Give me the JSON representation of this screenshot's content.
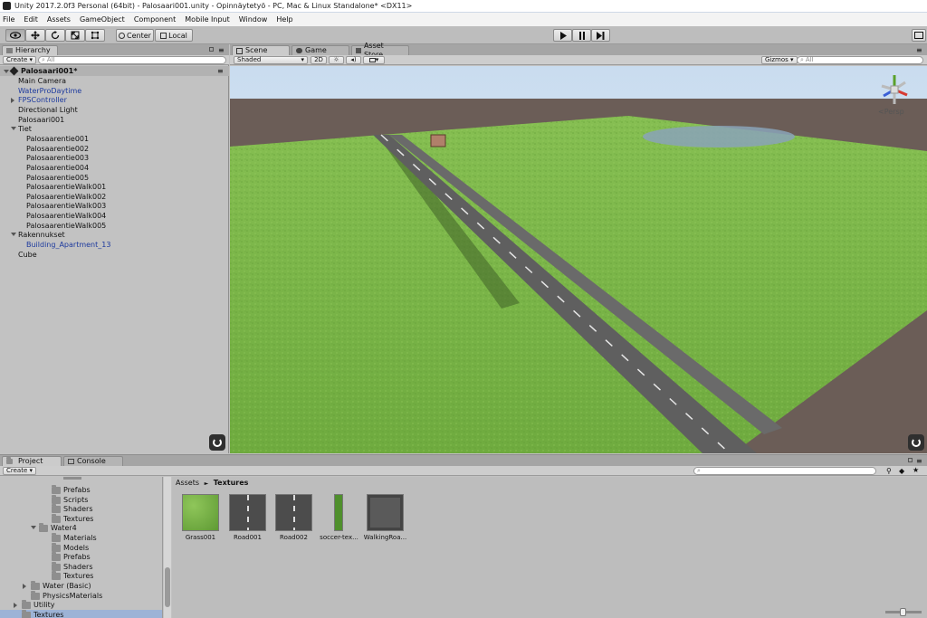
{
  "window": {
    "title": "Unity 2017.2.0f3 Personal (64bit) - Palosaari001.unity - Opinnäytetyö - PC, Mac & Linux Standalone* <DX11>"
  },
  "menu": [
    "File",
    "Edit",
    "Assets",
    "GameObject",
    "Component",
    "Mobile Input",
    "Window",
    "Help"
  ],
  "toolbar": {
    "center": "Center",
    "local": "Local"
  },
  "hierarchy": {
    "tab": "Hierarchy",
    "create": "Create",
    "search_placeholder": "All",
    "scene_name": "Palosaari001*",
    "items": [
      {
        "label": "Main Camera",
        "indent": 1,
        "blue": false,
        "arrow": ""
      },
      {
        "label": "WaterProDaytime",
        "indent": 1,
        "blue": true,
        "arrow": ""
      },
      {
        "label": "FPSController",
        "indent": 0,
        "blue": true,
        "arrow": "right"
      },
      {
        "label": "Directional Light",
        "indent": 1,
        "blue": false,
        "arrow": ""
      },
      {
        "label": "Palosaari001",
        "indent": 1,
        "blue": false,
        "arrow": ""
      },
      {
        "label": "Tiet",
        "indent": 0,
        "blue": false,
        "arrow": "down"
      },
      {
        "label": "Palosaarentie001",
        "indent": 2,
        "blue": false,
        "arrow": ""
      },
      {
        "label": "Palosaarentie002",
        "indent": 2,
        "blue": false,
        "arrow": ""
      },
      {
        "label": "Palosaarentie003",
        "indent": 2,
        "blue": false,
        "arrow": ""
      },
      {
        "label": "Palosaarentie004",
        "indent": 2,
        "blue": false,
        "arrow": ""
      },
      {
        "label": "Palosaarentie005",
        "indent": 2,
        "blue": false,
        "arrow": ""
      },
      {
        "label": "PalosaarentieWalk001",
        "indent": 2,
        "blue": false,
        "arrow": ""
      },
      {
        "label": "PalosaarentieWalk002",
        "indent": 2,
        "blue": false,
        "arrow": ""
      },
      {
        "label": "PalosaarentieWalk003",
        "indent": 2,
        "blue": false,
        "arrow": ""
      },
      {
        "label": "PalosaarentieWalk004",
        "indent": 2,
        "blue": false,
        "arrow": ""
      },
      {
        "label": "PalosaarentieWalk005",
        "indent": 2,
        "blue": false,
        "arrow": ""
      },
      {
        "label": "Rakennukset",
        "indent": 0,
        "blue": false,
        "arrow": "down"
      },
      {
        "label": "Building_Apartment_13",
        "indent": 2,
        "blue": true,
        "arrow": ""
      },
      {
        "label": "Cube",
        "indent": 1,
        "blue": false,
        "arrow": ""
      }
    ]
  },
  "scene": {
    "tabs": {
      "scene": "Scene",
      "game": "Game",
      "asset_store": "Asset Store"
    },
    "shading": "Shaded",
    "mode_2d": "2D",
    "gizmos": "Gizmos",
    "search_placeholder": "All",
    "persp": "Persp"
  },
  "project": {
    "tabs": {
      "project": "Project",
      "console": "Console"
    },
    "create": "Create",
    "tree": [
      {
        "label": "Prefabs",
        "indent": 3,
        "arrow": ""
      },
      {
        "label": "Scripts",
        "indent": 3,
        "arrow": ""
      },
      {
        "label": "Shaders",
        "indent": 3,
        "arrow": ""
      },
      {
        "label": "Textures",
        "indent": 3,
        "arrow": ""
      },
      {
        "label": "Water4",
        "indent": 2,
        "arrow": "down"
      },
      {
        "label": "Materials",
        "indent": 3,
        "arrow": ""
      },
      {
        "label": "Models",
        "indent": 3,
        "arrow": ""
      },
      {
        "label": "Prefabs",
        "indent": 3,
        "arrow": ""
      },
      {
        "label": "Shaders",
        "indent": 3,
        "arrow": ""
      },
      {
        "label": "Textures",
        "indent": 3,
        "arrow": ""
      },
      {
        "label": "Water (Basic)",
        "indent": 1,
        "arrow": "right"
      },
      {
        "label": "PhysicsMaterials",
        "indent": 1,
        "arrow": ""
      },
      {
        "label": "Utility",
        "indent": 0,
        "arrow": "right"
      },
      {
        "label": "Textures",
        "indent": 0,
        "arrow": ""
      }
    ],
    "breadcrumb": {
      "root": "Assets",
      "sep": "►",
      "current": "Textures"
    },
    "assets": [
      {
        "name": "Grass001",
        "kind": "grass"
      },
      {
        "name": "Road001",
        "kind": "road"
      },
      {
        "name": "Road002",
        "kind": "road"
      },
      {
        "name": "soccer-tex...",
        "kind": "strip"
      },
      {
        "name": "WalkingRoa...",
        "kind": "walk"
      }
    ]
  }
}
